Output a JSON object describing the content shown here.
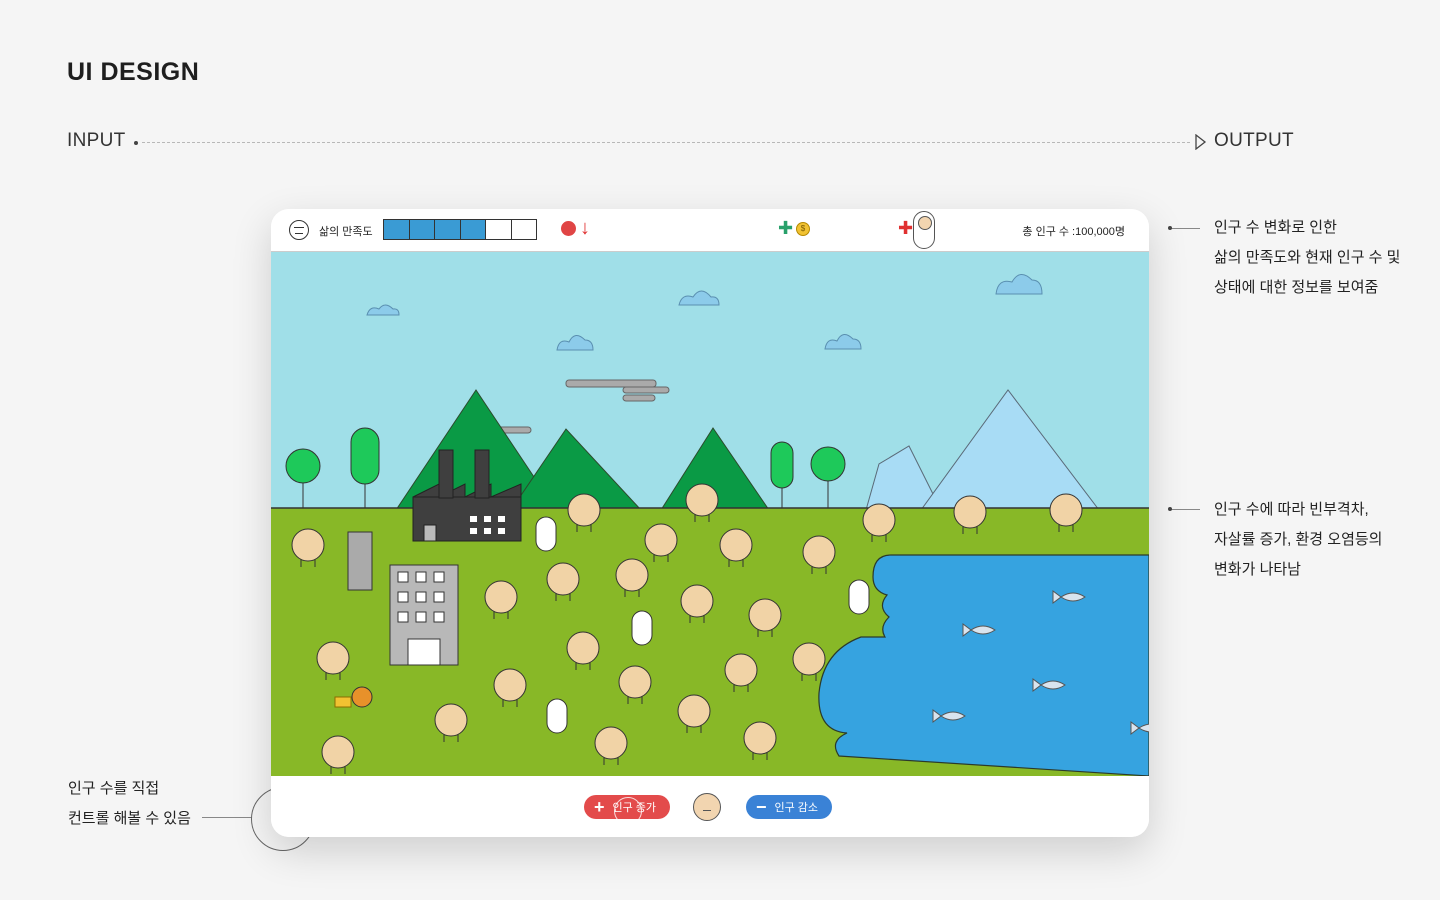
{
  "page": {
    "title": "UI DESIGN",
    "input_label": "INPUT",
    "output_label": "OUTPUT"
  },
  "notes": {
    "top": [
      "인구 수 변화로 인한",
      "삶의 만족도와 현재 인구 수 및",
      "상태에 대한 정보를 보여줌"
    ],
    "middle": [
      "인구 수에 따라 빈부격차,",
      "자살률 증가, 환경 오염등의",
      "변화가 나타남"
    ],
    "bottom": [
      "인구 수를 직접",
      "컨트롤 해볼 수 있음"
    ]
  },
  "game": {
    "satisfaction_label": "삶의 만족도",
    "satisfaction_level": 0.67,
    "coin_symbol": "$",
    "population_total": "총 인구 수 :100,000명",
    "increase_label": "인구 증가",
    "decrease_label": "인구 감소"
  },
  "colors": {
    "sky": "#a0dfe8",
    "grass": "#88b827",
    "lake": "#36a3e0",
    "mountain": "#0a9a45",
    "ice_mountain": "#a8dcf5",
    "increase": "#e34b4b",
    "decrease": "#3a82d6",
    "satisfaction_fill": "#3a9bd4"
  },
  "icons": [
    "neutral-face-icon",
    "sad-face-icon",
    "down-arrow-icon",
    "plus-icon",
    "coin-icon",
    "baby-icon",
    "minus-icon",
    "fish-icon",
    "factory-icon",
    "tree-icon",
    "cloud-icon"
  ]
}
